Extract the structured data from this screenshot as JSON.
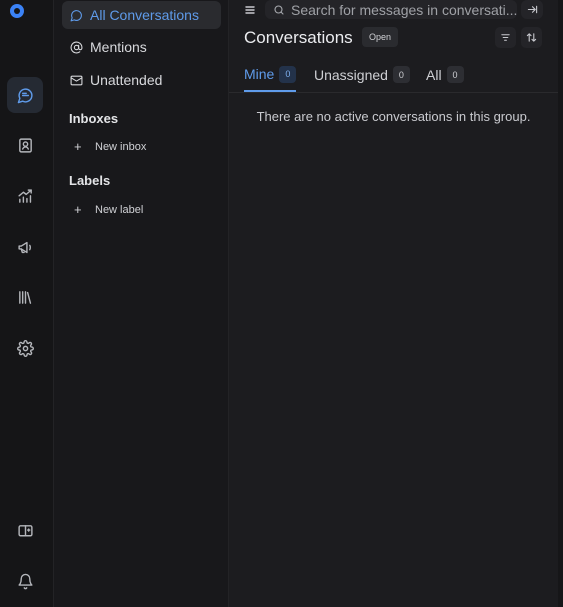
{
  "app": {
    "brand_color": "#3b82f6",
    "accent": "#5f9bea"
  },
  "rail": {
    "items": [
      {
        "icon": "chat-bubble-icon",
        "active": true
      },
      {
        "icon": "contacts-icon",
        "active": false
      },
      {
        "icon": "reports-icon",
        "active": false
      },
      {
        "icon": "campaigns-megaphone-icon",
        "active": false
      },
      {
        "icon": "library-icon",
        "active": false
      },
      {
        "icon": "settings-gear-icon",
        "active": false
      }
    ],
    "bottom": [
      {
        "icon": "switch-layout-icon"
      },
      {
        "icon": "notification-bell-icon"
      }
    ]
  },
  "sidebar": {
    "nav": [
      {
        "label": "All Conversations",
        "icon": "chat-bubble-icon",
        "active": true
      },
      {
        "label": "Mentions",
        "icon": "at-sign-icon",
        "active": false
      },
      {
        "label": "Unattended",
        "icon": "mail-icon",
        "active": false
      }
    ],
    "inboxes": {
      "title": "Inboxes",
      "add_label": "New inbox"
    },
    "labels": {
      "title": "Labels",
      "add_label": "New label"
    }
  },
  "header": {
    "search_placeholder": "Search for messages in conversati...",
    "title": "Conversations",
    "status": "Open"
  },
  "tabs": [
    {
      "label": "Mine",
      "count": "0",
      "active": true
    },
    {
      "label": "Unassigned",
      "count": "0",
      "active": false
    },
    {
      "label": "All",
      "count": "0",
      "active": false
    }
  ],
  "empty_message": "There are no active conversations in this group."
}
